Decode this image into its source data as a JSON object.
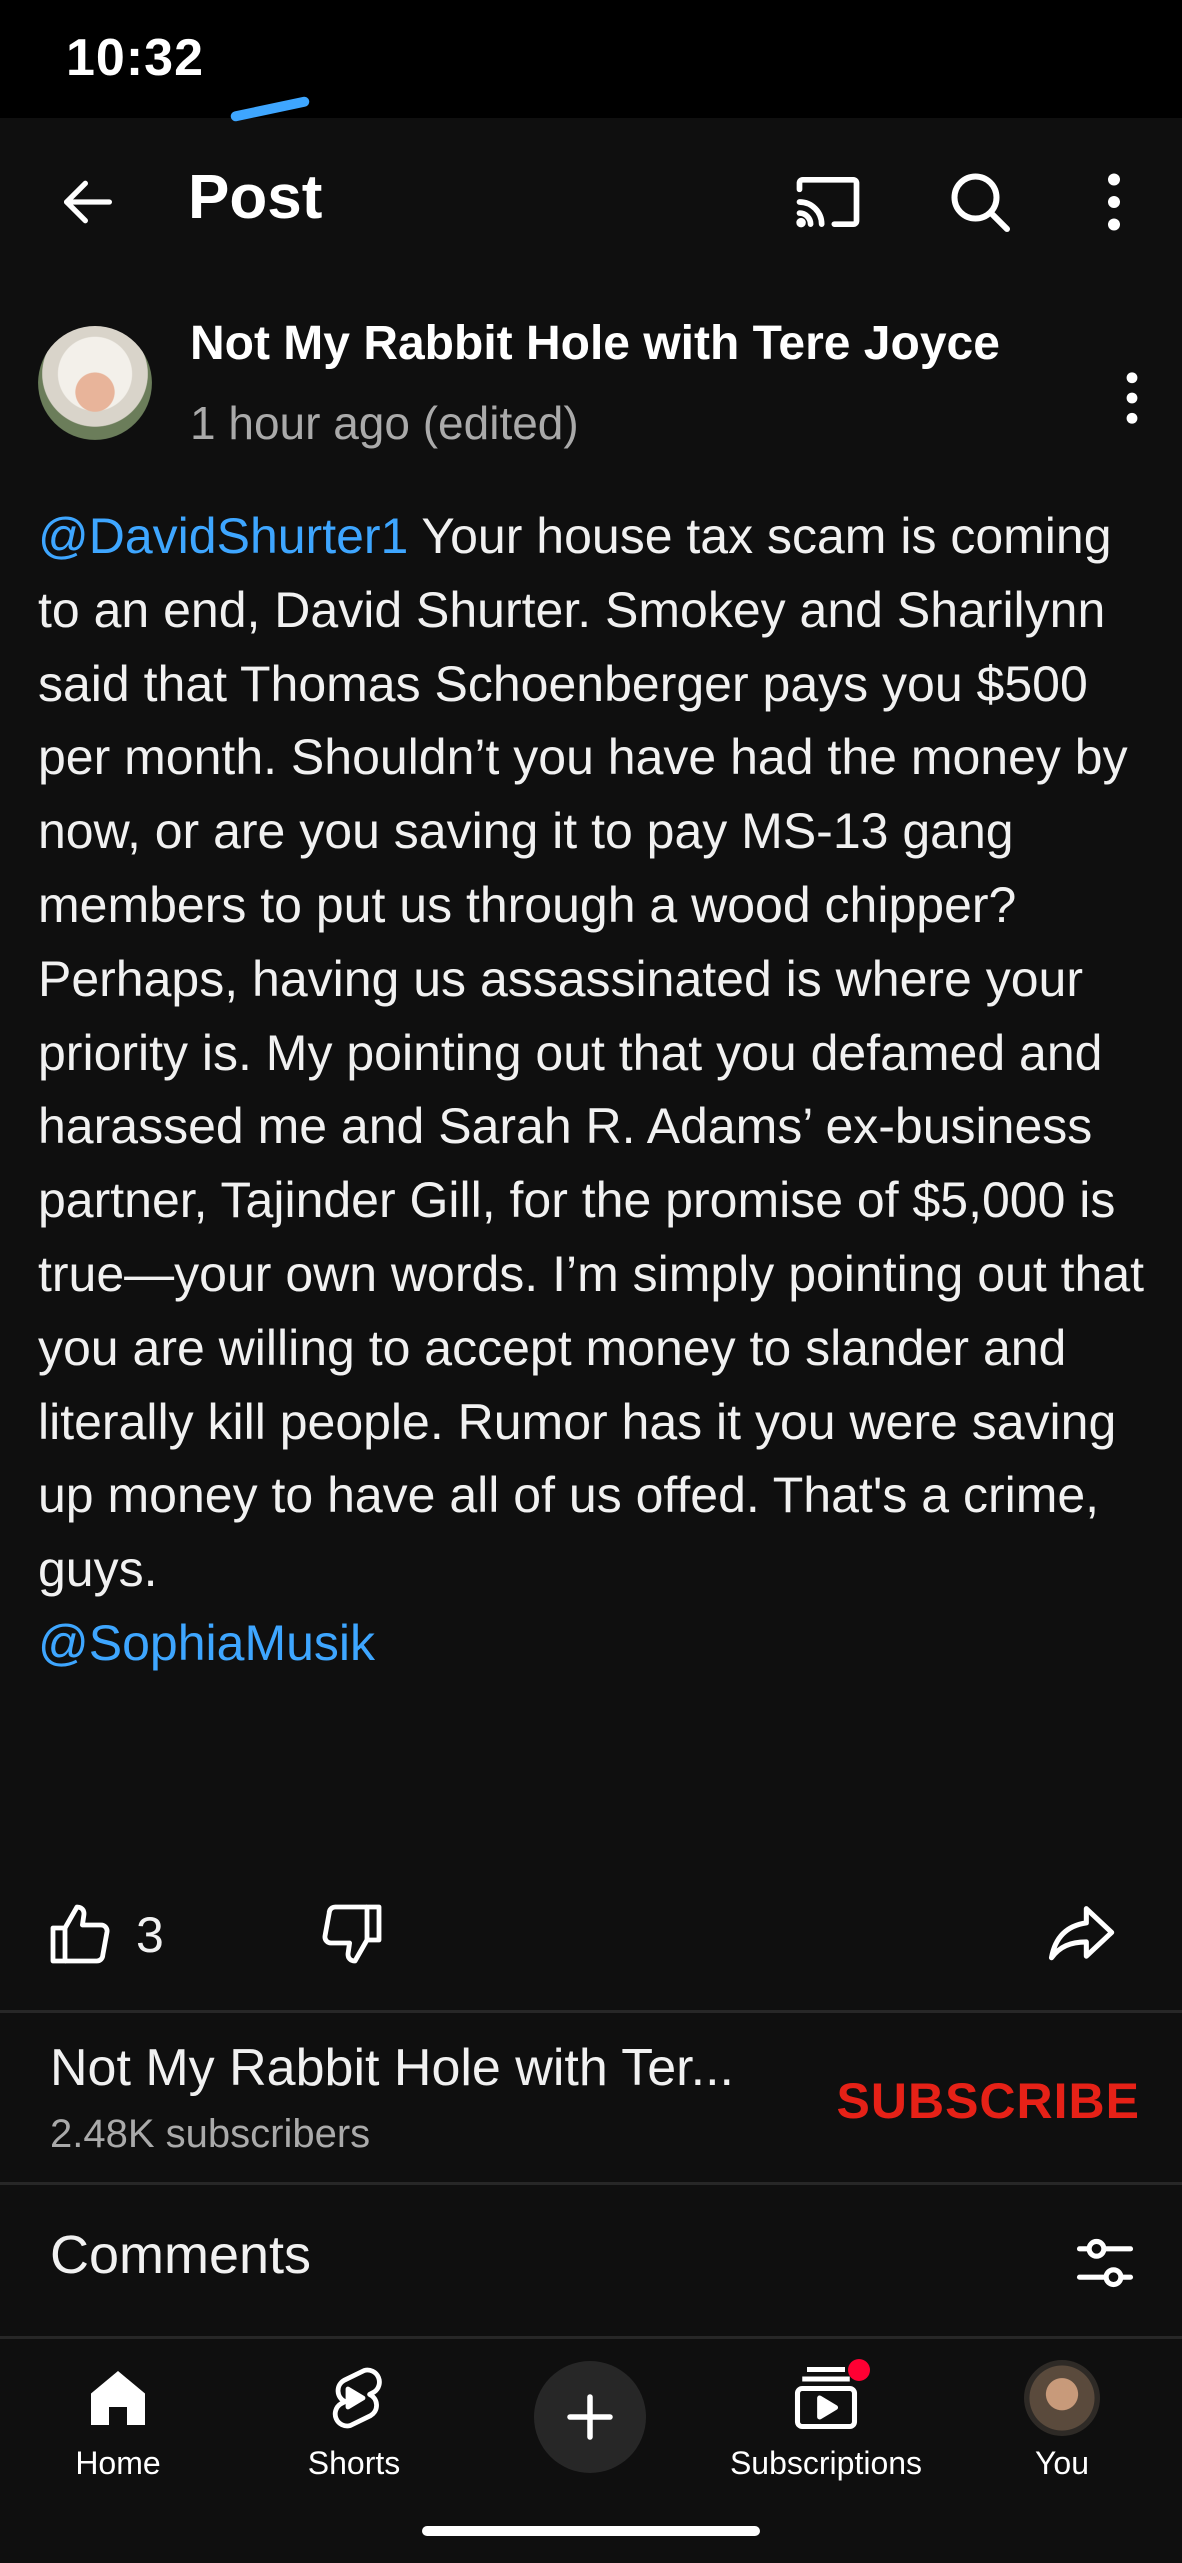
{
  "status_bar": {
    "time": "10:32"
  },
  "top_bar": {
    "title": "Post",
    "icons": [
      "back-arrow-icon",
      "cast-icon",
      "search-icon",
      "more-vert-icon"
    ]
  },
  "post": {
    "channel_name": "Not My Rabbit Hole with Tere Joyce",
    "time": "1 hour ago (edited)",
    "mention_start": "@DavidShurter1",
    "text": " Your house tax scam is coming to an end, David Shurter. Smokey and Sharilynn said that Thomas Schoenberger pays you $500 per month. Shouldn’t you have had the money by now, or are you saving it to pay MS-13 gang members to put us through a wood chipper?  Perhaps, having us assassinated is where your priority is. My pointing out that you defamed and harassed me and Sarah R. Adams’ ex-business partner, Tajinder Gill, for the promise of $5,000 is true—your own words. I’m simply pointing out that you are willing to accept money to slander and literally kill people. Rumor has it you were saving up money to have all of us offed. That's a crime, guys.",
    "mention_end": "@SophiaMusik",
    "like_count": "3"
  },
  "channel": {
    "name": "Not My Rabbit Hole with Ter...",
    "subscribers": "2.48K subscribers",
    "subscribe_label": "SUBSCRIBE"
  },
  "comments": {
    "label": "Comments"
  },
  "bottom_nav": {
    "items": [
      {
        "label": "Home",
        "icon": "home-icon"
      },
      {
        "label": "Shorts",
        "icon": "shorts-icon"
      },
      {
        "label": "",
        "icon": "create-plus-icon"
      },
      {
        "label": "Subscriptions",
        "icon": "subscriptions-icon"
      },
      {
        "label": "You",
        "icon": "avatar"
      }
    ]
  },
  "colors": {
    "background": "#0f0f0f",
    "mention": "#3ea6ff",
    "subscribe": "#e62117",
    "notification_dot": "#ff0033"
  }
}
